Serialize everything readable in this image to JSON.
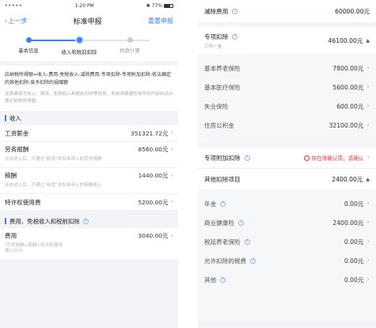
{
  "left": {
    "status": {
      "signal": "••••• ",
      "time": "1:20 PM",
      "bluetooth": "✱",
      "battery": "77%"
    },
    "nav": {
      "back": "上一步",
      "title": "标准申报",
      "reset": "重置申报"
    },
    "steps": [
      {
        "label": "基本信息",
        "state": "done"
      },
      {
        "label": "收入和税前扣除",
        "state": "active"
      },
      {
        "label": "税款计算",
        "state": "todo"
      }
    ],
    "formula": {
      "text": "应纳税所得额=收入-费用-免税收入-减除费用-专项扣除-专项附加扣除-依法确定的其他扣除-准予扣除的捐赠额",
      "note": "该表确填写收入、费用、免税收入和税前扣除等信息，系统将根据您填写的内容自动计算应纳税所得额。"
    },
    "income_section": {
      "title": "收入"
    },
    "income_rows": [
      {
        "label": "工资薪金",
        "value": "351321.72元",
        "hint": ""
      },
      {
        "label": "劳务报酬",
        "value": "8560.00元",
        "hint": "点击进入后，可通过\"新增\"添加未带入的劳务报酬"
      },
      {
        "label": "稿酬",
        "value": "1440.00元",
        "hint": "点击进入后，可通过\"新增\"添加未带入的稿酬收入"
      },
      {
        "label": "特许权使用费",
        "value": "5200.00元",
        "hint": ""
      }
    ],
    "expense_section": {
      "title": "费用、免税收入和税前扣除"
    },
    "expense_row": {
      "label": "费用",
      "value": "3040.00元",
      "hint1": "(劳务报酬+稿酬+特许权使用",
      "hint2": "费)*20%"
    }
  },
  "right": {
    "reduction": {
      "label": "减除费用",
      "value": "60000.00元"
    },
    "special": {
      "label": "专项扣除",
      "sublabel": "三险一金",
      "value": "46100.00元"
    },
    "special_items": [
      {
        "label": "基本养老保险",
        "value": "7800.00元"
      },
      {
        "label": "基本医疗保险",
        "value": "5600.00元"
      },
      {
        "label": "失业保险",
        "value": "600.00元"
      },
      {
        "label": "住房公积金",
        "value": "32100.00元"
      }
    ],
    "additional": {
      "label": "专项附加扣除",
      "warning": "存在待确认项，请确认"
    },
    "other": {
      "label": "其他扣除项目",
      "value": "2400.00元"
    },
    "other_items": [
      {
        "label": "年金",
        "value": "0.00元"
      },
      {
        "label": "商业健康险",
        "value": "2400.00元"
      },
      {
        "label": "税延养老保险",
        "value": "0.00元"
      },
      {
        "label": "允许扣除的税费",
        "value": "0.00元"
      },
      {
        "label": "其他",
        "value": "0.00元"
      }
    ]
  }
}
